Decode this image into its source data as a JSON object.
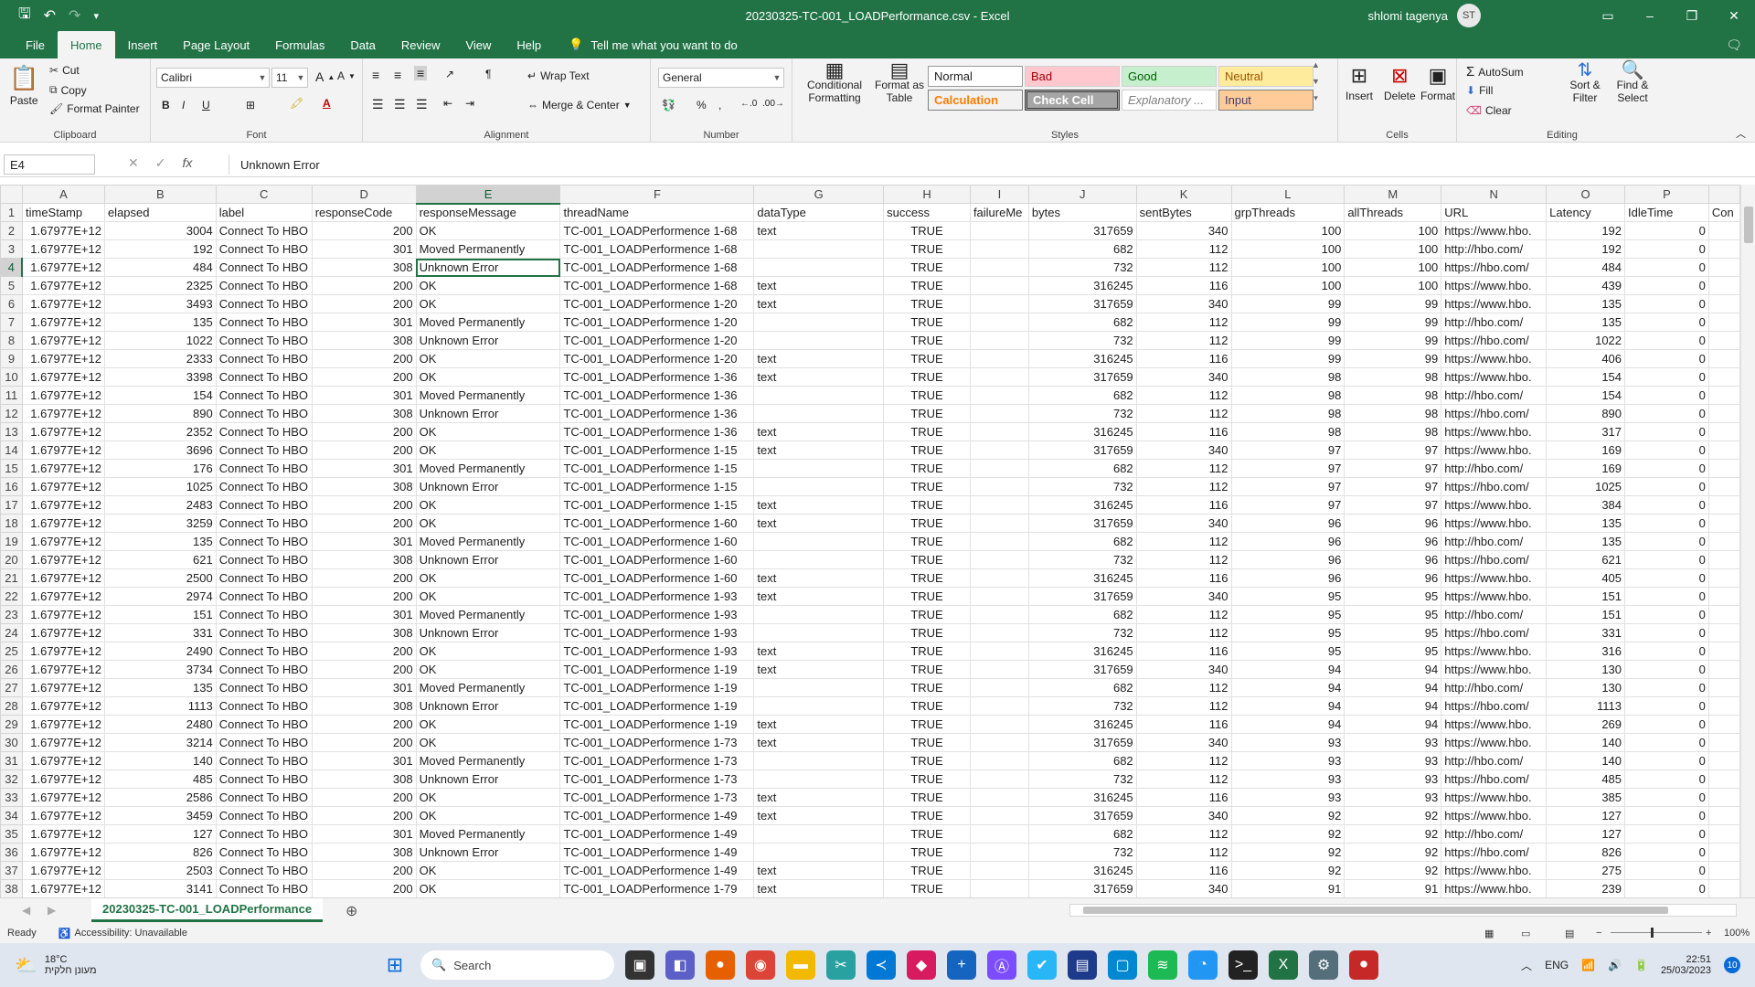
{
  "window": {
    "title": "20230325-TC-001_LOADPerformance.csv  -  Excel",
    "user": "shlomi tagenya",
    "avatar_initials": "ST"
  },
  "menu": {
    "tabs": [
      "File",
      "Home",
      "Insert",
      "Page Layout",
      "Formulas",
      "Data",
      "Review",
      "View",
      "Help"
    ],
    "active": "Home",
    "tell_me": "Tell me what you want to do"
  },
  "ribbon": {
    "clipboard": {
      "paste": "Paste",
      "cut": "Cut",
      "copy": "Copy",
      "format_painter": "Format Painter",
      "label": "Clipboard"
    },
    "font": {
      "name": "Calibri",
      "size": "11",
      "label": "Font"
    },
    "alignment": {
      "wrap": "Wrap Text",
      "merge": "Merge & Center",
      "label": "Alignment"
    },
    "number": {
      "format": "General",
      "label": "Number"
    },
    "styles": {
      "conditional": "Conditional Formatting",
      "format_table": "Format as Table",
      "label": "Styles",
      "cells": [
        {
          "name": "Normal",
          "bg": "#ffffff",
          "fg": "#222222"
        },
        {
          "name": "Bad",
          "bg": "#ffc7ce",
          "fg": "#9c0006"
        },
        {
          "name": "Good",
          "bg": "#c6efce",
          "fg": "#006100"
        },
        {
          "name": "Neutral",
          "bg": "#ffeb9c",
          "fg": "#9c5700"
        },
        {
          "name": "Calculation",
          "bg": "#f2f2f2",
          "fg": "#fa7d00"
        },
        {
          "name": "Check Cell",
          "bg": "#a5a5a5",
          "fg": "#ffffff"
        },
        {
          "name": "Explanatory ...",
          "bg": "#ffffff",
          "fg": "#7f7f7f"
        },
        {
          "name": "Input",
          "bg": "#ffcc99",
          "fg": "#3f3f76"
        }
      ]
    },
    "cells": {
      "insert": "Insert",
      "delete": "Delete",
      "format": "Format",
      "label": "Cells"
    },
    "editing": {
      "autosum": "AutoSum",
      "fill": "Fill",
      "clear": "Clear",
      "sort": "Sort & Filter",
      "find": "Find & Select",
      "label": "Editing"
    }
  },
  "formula_bar": {
    "name_box": "E4",
    "content": "Unknown Error"
  },
  "columns": [
    "A",
    "B",
    "C",
    "D",
    "E",
    "F",
    "G",
    "H",
    "I",
    "J",
    "K",
    "L",
    "M",
    "N",
    "O",
    "P",
    ""
  ],
  "headers": [
    "timeStamp",
    "elapsed",
    "label",
    "responseCode",
    "responseMessage",
    "threadName",
    "dataType",
    "success",
    "failureMe",
    "bytes",
    "sentBytes",
    "grpThreads",
    "allThreads",
    "URL",
    "Latency",
    "IdleTime",
    "Con"
  ],
  "rows": [
    [
      "1.67977E+12",
      "3004",
      "Connect To  HBO",
      "200",
      "OK",
      "TC-001_LOADPerformence 1-68",
      "text",
      "TRUE",
      "",
      "317659",
      "340",
      "100",
      "100",
      "https://www.hbo.",
      "192",
      "0"
    ],
    [
      "1.67977E+12",
      "192",
      "Connect To  HBO",
      "301",
      "Moved Permanently",
      "TC-001_LOADPerformence 1-68",
      "",
      "TRUE",
      "",
      "682",
      "112",
      "100",
      "100",
      "http://hbo.com/",
      "192",
      "0"
    ],
    [
      "1.67977E+12",
      "484",
      "Connect To  HBO",
      "308",
      "Unknown Error",
      "TC-001_LOADPerformence 1-68",
      "",
      "TRUE",
      "",
      "732",
      "112",
      "100",
      "100",
      "https://hbo.com/",
      "484",
      "0"
    ],
    [
      "1.67977E+12",
      "2325",
      "Connect To  HBO",
      "200",
      "OK",
      "TC-001_LOADPerformence 1-68",
      "text",
      "TRUE",
      "",
      "316245",
      "116",
      "100",
      "100",
      "https://www.hbo.",
      "439",
      "0"
    ],
    [
      "1.67977E+12",
      "3493",
      "Connect To  HBO",
      "200",
      "OK",
      "TC-001_LOADPerformence 1-20",
      "text",
      "TRUE",
      "",
      "317659",
      "340",
      "99",
      "99",
      "https://www.hbo.",
      "135",
      "0"
    ],
    [
      "1.67977E+12",
      "135",
      "Connect To  HBO",
      "301",
      "Moved Permanently",
      "TC-001_LOADPerformence 1-20",
      "",
      "TRUE",
      "",
      "682",
      "112",
      "99",
      "99",
      "http://hbo.com/",
      "135",
      "0"
    ],
    [
      "1.67977E+12",
      "1022",
      "Connect To  HBO",
      "308",
      "Unknown Error",
      "TC-001_LOADPerformence 1-20",
      "",
      "TRUE",
      "",
      "732",
      "112",
      "99",
      "99",
      "https://hbo.com/",
      "1022",
      "0"
    ],
    [
      "1.67977E+12",
      "2333",
      "Connect To  HBO",
      "200",
      "OK",
      "TC-001_LOADPerformence 1-20",
      "text",
      "TRUE",
      "",
      "316245",
      "116",
      "99",
      "99",
      "https://www.hbo.",
      "406",
      "0"
    ],
    [
      "1.67977E+12",
      "3398",
      "Connect To  HBO",
      "200",
      "OK",
      "TC-001_LOADPerformence 1-36",
      "text",
      "TRUE",
      "",
      "317659",
      "340",
      "98",
      "98",
      "https://www.hbo.",
      "154",
      "0"
    ],
    [
      "1.67977E+12",
      "154",
      "Connect To  HBO",
      "301",
      "Moved Permanently",
      "TC-001_LOADPerformence 1-36",
      "",
      "TRUE",
      "",
      "682",
      "112",
      "98",
      "98",
      "http://hbo.com/",
      "154",
      "0"
    ],
    [
      "1.67977E+12",
      "890",
      "Connect To  HBO",
      "308",
      "Unknown Error",
      "TC-001_LOADPerformence 1-36",
      "",
      "TRUE",
      "",
      "732",
      "112",
      "98",
      "98",
      "https://hbo.com/",
      "890",
      "0"
    ],
    [
      "1.67977E+12",
      "2352",
      "Connect To  HBO",
      "200",
      "OK",
      "TC-001_LOADPerformence 1-36",
      "text",
      "TRUE",
      "",
      "316245",
      "116",
      "98",
      "98",
      "https://www.hbo.",
      "317",
      "0"
    ],
    [
      "1.67977E+12",
      "3696",
      "Connect To  HBO",
      "200",
      "OK",
      "TC-001_LOADPerformence 1-15",
      "text",
      "TRUE",
      "",
      "317659",
      "340",
      "97",
      "97",
      "https://www.hbo.",
      "169",
      "0"
    ],
    [
      "1.67977E+12",
      "176",
      "Connect To  HBO",
      "301",
      "Moved Permanently",
      "TC-001_LOADPerformence 1-15",
      "",
      "TRUE",
      "",
      "682",
      "112",
      "97",
      "97",
      "http://hbo.com/",
      "169",
      "0"
    ],
    [
      "1.67977E+12",
      "1025",
      "Connect To  HBO",
      "308",
      "Unknown Error",
      "TC-001_LOADPerformence 1-15",
      "",
      "TRUE",
      "",
      "732",
      "112",
      "97",
      "97",
      "https://hbo.com/",
      "1025",
      "0"
    ],
    [
      "1.67977E+12",
      "2483",
      "Connect To  HBO",
      "200",
      "OK",
      "TC-001_LOADPerformence 1-15",
      "text",
      "TRUE",
      "",
      "316245",
      "116",
      "97",
      "97",
      "https://www.hbo.",
      "384",
      "0"
    ],
    [
      "1.67977E+12",
      "3259",
      "Connect To  HBO",
      "200",
      "OK",
      "TC-001_LOADPerformence 1-60",
      "text",
      "TRUE",
      "",
      "317659",
      "340",
      "96",
      "96",
      "https://www.hbo.",
      "135",
      "0"
    ],
    [
      "1.67977E+12",
      "135",
      "Connect To  HBO",
      "301",
      "Moved Permanently",
      "TC-001_LOADPerformence 1-60",
      "",
      "TRUE",
      "",
      "682",
      "112",
      "96",
      "96",
      "http://hbo.com/",
      "135",
      "0"
    ],
    [
      "1.67977E+12",
      "621",
      "Connect To  HBO",
      "308",
      "Unknown Error",
      "TC-001_LOADPerformence 1-60",
      "",
      "TRUE",
      "",
      "732",
      "112",
      "96",
      "96",
      "https://hbo.com/",
      "621",
      "0"
    ],
    [
      "1.67977E+12",
      "2500",
      "Connect To  HBO",
      "200",
      "OK",
      "TC-001_LOADPerformence 1-60",
      "text",
      "TRUE",
      "",
      "316245",
      "116",
      "96",
      "96",
      "https://www.hbo.",
      "405",
      "0"
    ],
    [
      "1.67977E+12",
      "2974",
      "Connect To  HBO",
      "200",
      "OK",
      "TC-001_LOADPerformence 1-93",
      "text",
      "TRUE",
      "",
      "317659",
      "340",
      "95",
      "95",
      "https://www.hbo.",
      "151",
      "0"
    ],
    [
      "1.67977E+12",
      "151",
      "Connect To  HBO",
      "301",
      "Moved Permanently",
      "TC-001_LOADPerformence 1-93",
      "",
      "TRUE",
      "",
      "682",
      "112",
      "95",
      "95",
      "http://hbo.com/",
      "151",
      "0"
    ],
    [
      "1.67977E+12",
      "331",
      "Connect To  HBO",
      "308",
      "Unknown Error",
      "TC-001_LOADPerformence 1-93",
      "",
      "TRUE",
      "",
      "732",
      "112",
      "95",
      "95",
      "https://hbo.com/",
      "331",
      "0"
    ],
    [
      "1.67977E+12",
      "2490",
      "Connect To  HBO",
      "200",
      "OK",
      "TC-001_LOADPerformence 1-93",
      "text",
      "TRUE",
      "",
      "316245",
      "116",
      "95",
      "95",
      "https://www.hbo.",
      "316",
      "0"
    ],
    [
      "1.67977E+12",
      "3734",
      "Connect To  HBO",
      "200",
      "OK",
      "TC-001_LOADPerformence 1-19",
      "text",
      "TRUE",
      "",
      "317659",
      "340",
      "94",
      "94",
      "https://www.hbo.",
      "130",
      "0"
    ],
    [
      "1.67977E+12",
      "135",
      "Connect To  HBO",
      "301",
      "Moved Permanently",
      "TC-001_LOADPerformence 1-19",
      "",
      "TRUE",
      "",
      "682",
      "112",
      "94",
      "94",
      "http://hbo.com/",
      "130",
      "0"
    ],
    [
      "1.67977E+12",
      "1113",
      "Connect To  HBO",
      "308",
      "Unknown Error",
      "TC-001_LOADPerformence 1-19",
      "",
      "TRUE",
      "",
      "732",
      "112",
      "94",
      "94",
      "https://hbo.com/",
      "1113",
      "0"
    ],
    [
      "1.67977E+12",
      "2480",
      "Connect To  HBO",
      "200",
      "OK",
      "TC-001_LOADPerformence 1-19",
      "text",
      "TRUE",
      "",
      "316245",
      "116",
      "94",
      "94",
      "https://www.hbo.",
      "269",
      "0"
    ],
    [
      "1.67977E+12",
      "3214",
      "Connect To  HBO",
      "200",
      "OK",
      "TC-001_LOADPerformence 1-73",
      "text",
      "TRUE",
      "",
      "317659",
      "340",
      "93",
      "93",
      "https://www.hbo.",
      "140",
      "0"
    ],
    [
      "1.67977E+12",
      "140",
      "Connect To  HBO",
      "301",
      "Moved Permanently",
      "TC-001_LOADPerformence 1-73",
      "",
      "TRUE",
      "",
      "682",
      "112",
      "93",
      "93",
      "http://hbo.com/",
      "140",
      "0"
    ],
    [
      "1.67977E+12",
      "485",
      "Connect To  HBO",
      "308",
      "Unknown Error",
      "TC-001_LOADPerformence 1-73",
      "",
      "TRUE",
      "",
      "732",
      "112",
      "93",
      "93",
      "https://hbo.com/",
      "485",
      "0"
    ],
    [
      "1.67977E+12",
      "2586",
      "Connect To  HBO",
      "200",
      "OK",
      "TC-001_LOADPerformence 1-73",
      "text",
      "TRUE",
      "",
      "316245",
      "116",
      "93",
      "93",
      "https://www.hbo.",
      "385",
      "0"
    ],
    [
      "1.67977E+12",
      "3459",
      "Connect To  HBO",
      "200",
      "OK",
      "TC-001_LOADPerformence 1-49",
      "text",
      "TRUE",
      "",
      "317659",
      "340",
      "92",
      "92",
      "https://www.hbo.",
      "127",
      "0"
    ],
    [
      "1.67977E+12",
      "127",
      "Connect To  HBO",
      "301",
      "Moved Permanently",
      "TC-001_LOADPerformence 1-49",
      "",
      "TRUE",
      "",
      "682",
      "112",
      "92",
      "92",
      "http://hbo.com/",
      "127",
      "0"
    ],
    [
      "1.67977E+12",
      "826",
      "Connect To  HBO",
      "308",
      "Unknown Error",
      "TC-001_LOADPerformence 1-49",
      "",
      "TRUE",
      "",
      "732",
      "112",
      "92",
      "92",
      "https://hbo.com/",
      "826",
      "0"
    ],
    [
      "1.67977E+12",
      "2503",
      "Connect To  HBO",
      "200",
      "OK",
      "TC-001_LOADPerformence 1-49",
      "text",
      "TRUE",
      "",
      "316245",
      "116",
      "92",
      "92",
      "https://www.hbo.",
      "275",
      "0"
    ],
    [
      "1.67977E+12",
      "3141",
      "Connect To  HBO",
      "200",
      "OK",
      "TC-001_LOADPerformence 1-79",
      "text",
      "TRUE",
      "",
      "317659",
      "340",
      "91",
      "91",
      "https://www.hbo.",
      "239",
      "0"
    ]
  ],
  "sheet": {
    "tab": "20230325-TC-001_LOADPerformance"
  },
  "status": {
    "ready": "Ready",
    "accessibility": "Accessibility: Unavailable",
    "zoom": "100%"
  },
  "taskbar": {
    "temp": "18°C",
    "weather": "מעונן חלקית",
    "search": "Search",
    "lang": "ENG",
    "time": "22:51",
    "date": "25/03/2023",
    "badge": "10"
  }
}
